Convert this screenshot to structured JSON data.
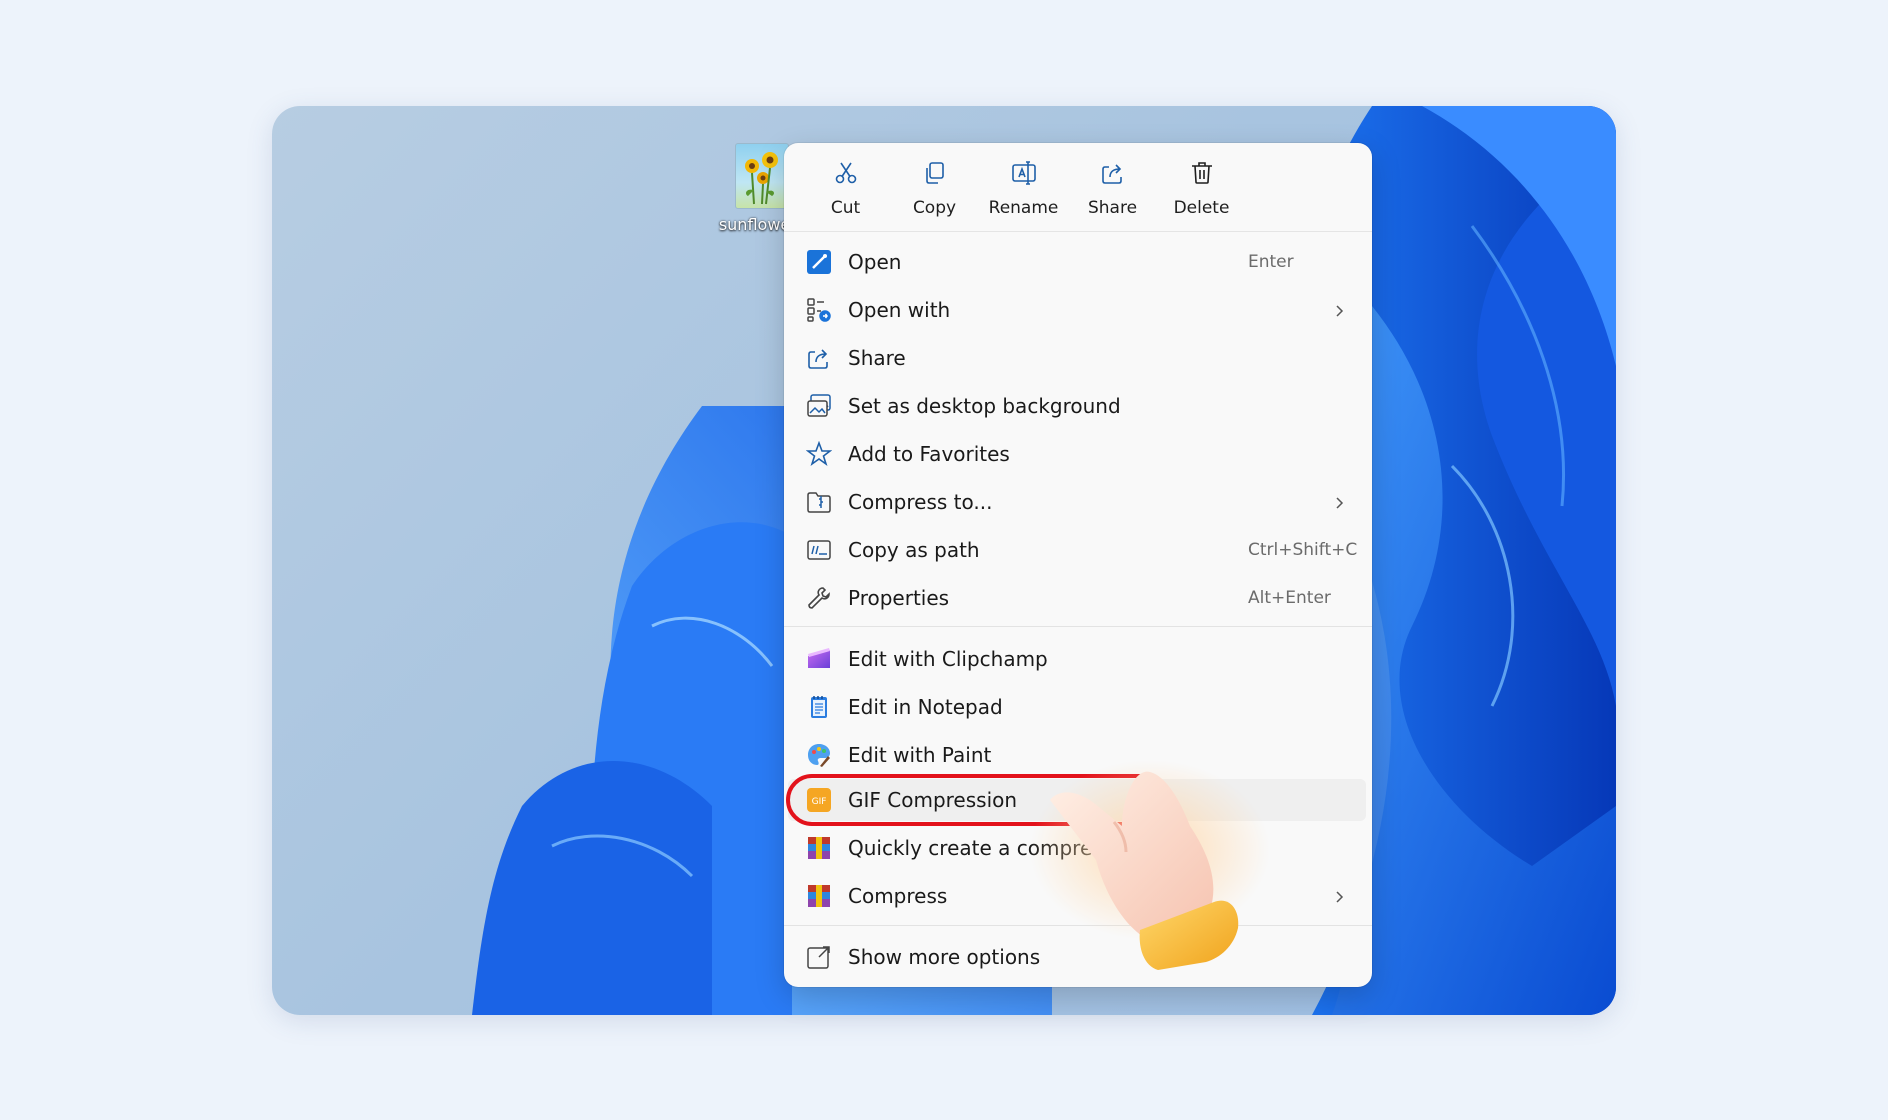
{
  "desktop": {
    "file_label": "sunflowers"
  },
  "toolbar": [
    {
      "label": "Cut",
      "icon": "scissors-icon"
    },
    {
      "label": "Copy",
      "icon": "copy-icon"
    },
    {
      "label": "Rename",
      "icon": "rename-icon"
    },
    {
      "label": "Share",
      "icon": "share-icon"
    },
    {
      "label": "Delete",
      "icon": "trash-icon"
    }
  ],
  "menu": {
    "open": {
      "label": "Open",
      "shortcut": "Enter"
    },
    "open_with": {
      "label": "Open with"
    },
    "share": {
      "label": "Share"
    },
    "set_background": {
      "label": "Set as desktop background"
    },
    "favorites": {
      "label": "Add to Favorites"
    },
    "compress_to": {
      "label": "Compress to..."
    },
    "copy_path": {
      "label": "Copy as path",
      "shortcut": "Ctrl+Shift+C"
    },
    "properties": {
      "label": "Properties",
      "shortcut": "Alt+Enter"
    },
    "clipchamp": {
      "label": "Edit with Clipchamp"
    },
    "notepad": {
      "label": "Edit in Notepad"
    },
    "paint": {
      "label": "Edit with Paint"
    },
    "gif": {
      "label": "GIF Compression"
    },
    "quick_compress": {
      "label": "Quickly create a compres"
    },
    "compress": {
      "label": "Compress"
    },
    "more": {
      "label": "Show more options"
    }
  },
  "colors": {
    "accent": "#0f6cbd",
    "highlight_ring": "#e3121b",
    "menu_bg": "#f9f9f9"
  }
}
